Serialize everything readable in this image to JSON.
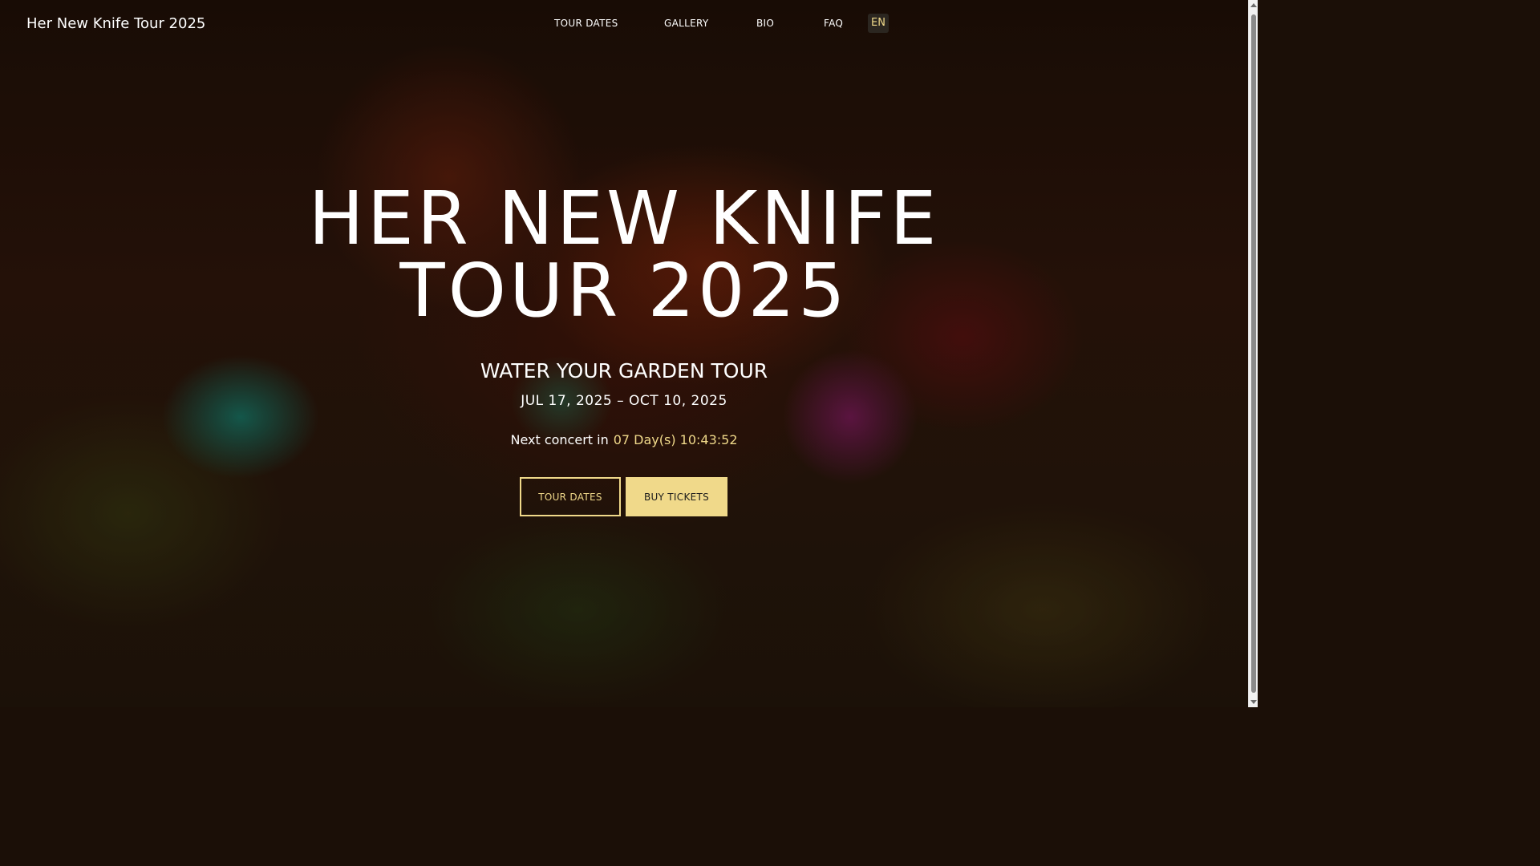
{
  "nav": {
    "brand": "Her New Knife Tour 2025",
    "links": [
      "TOUR DATES",
      "GALLERY",
      "BIO",
      "FAQ"
    ],
    "language": "EN"
  },
  "hero": {
    "title_line1": "HER NEW KNIFE",
    "title_line2": "TOUR 2025",
    "subtitle": "WATER YOUR GARDEN TOUR",
    "date_range": "JUL 17, 2025 – OCT 10, 2025",
    "countdown_label": "Next concert in",
    "countdown_value": "07 Day(s) 10:43:52",
    "buttons": {
      "tour_dates": "TOUR DATES",
      "buy_tickets": "BUY TICKETS"
    }
  },
  "colors": {
    "accent": "#f0d98a",
    "text": "#ffffff",
    "background": "#1b0f07"
  }
}
